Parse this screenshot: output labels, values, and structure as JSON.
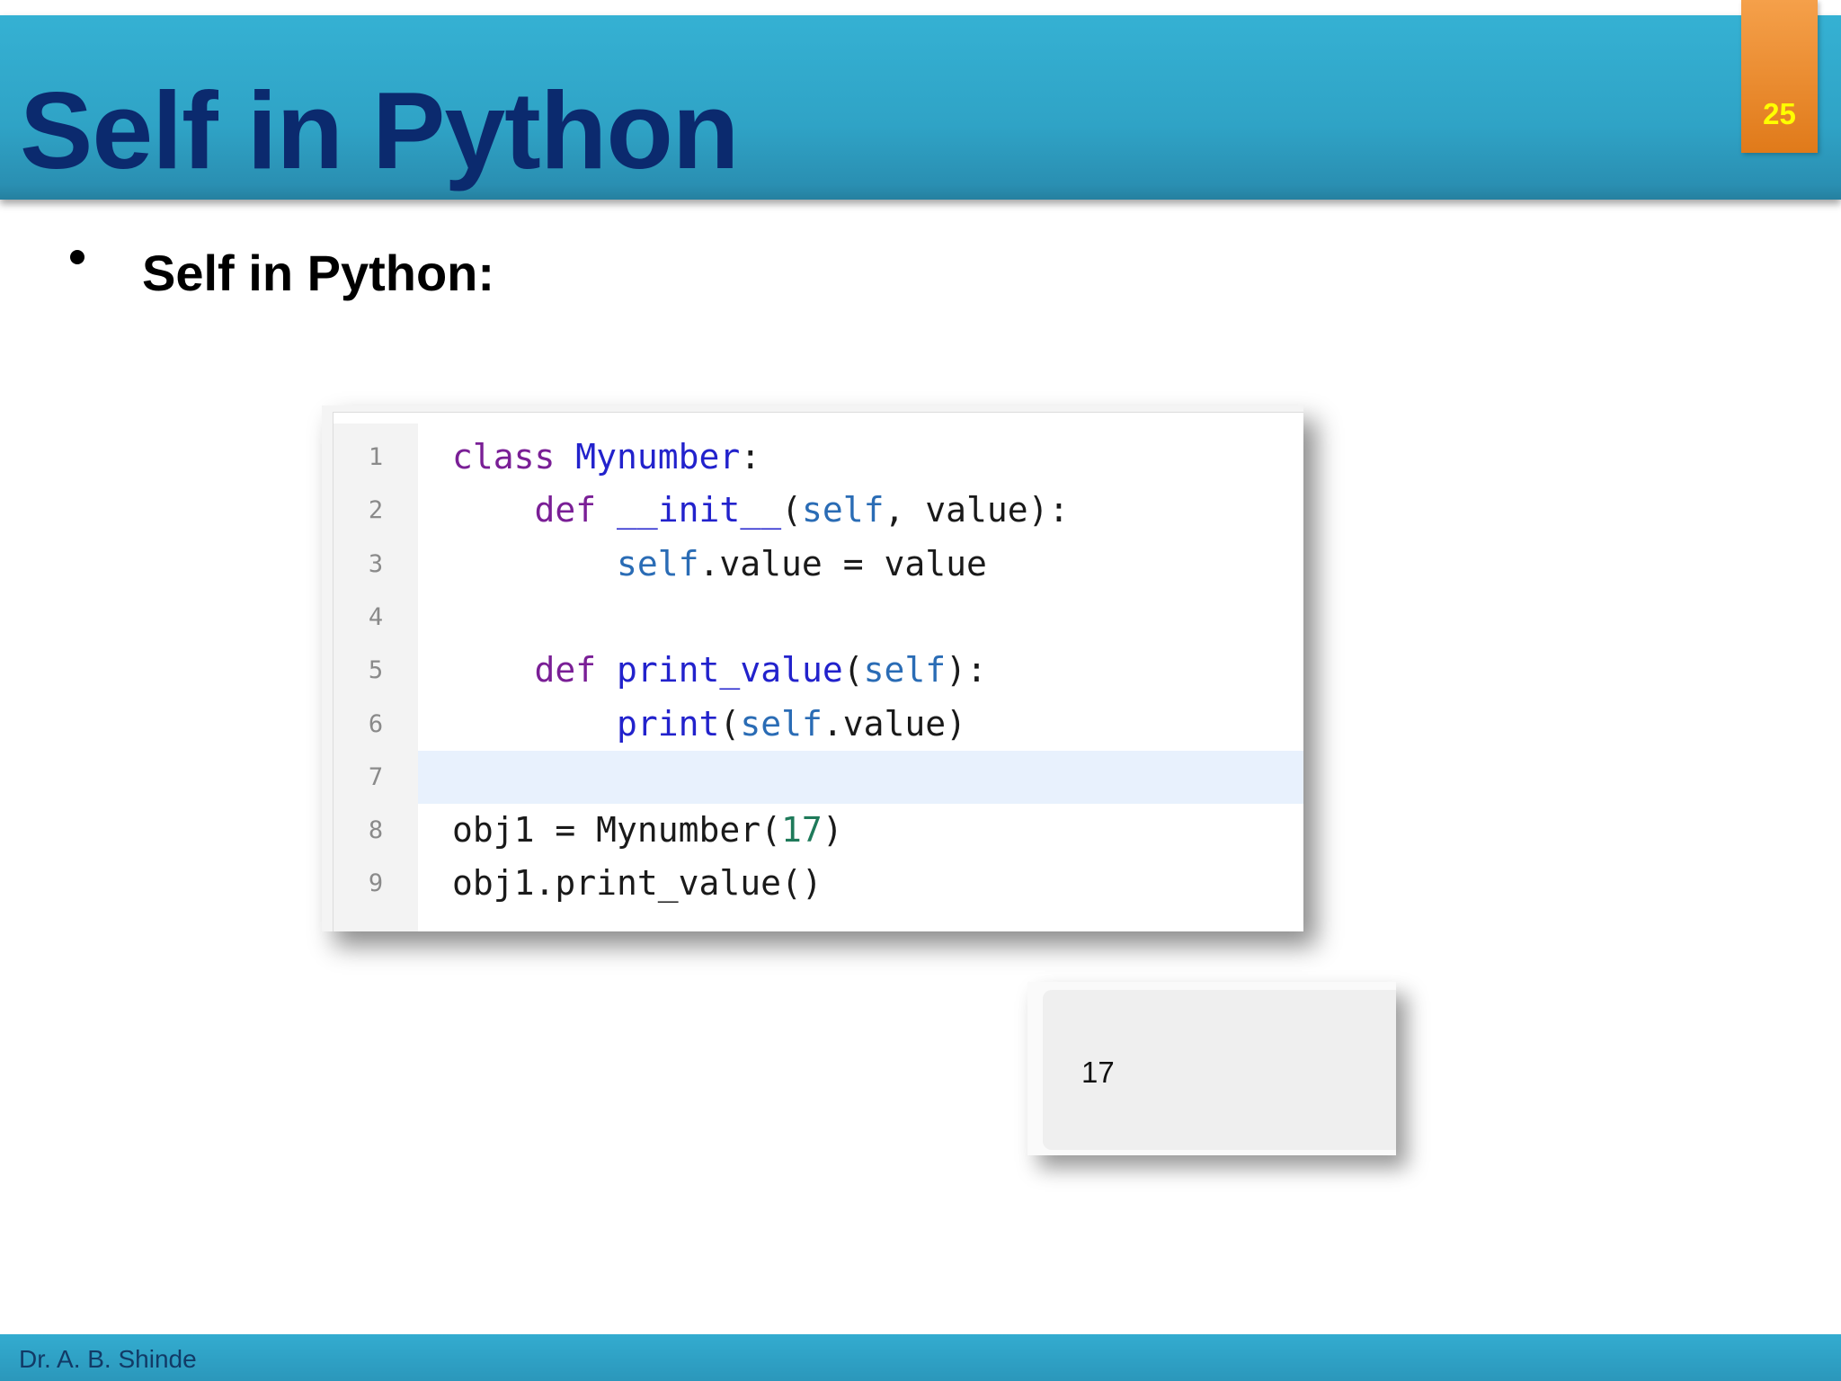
{
  "slide": {
    "title": "Self in Python",
    "page_number": "25",
    "bullet": "Self in Python:"
  },
  "code": {
    "line_numbers": [
      "1",
      "2",
      "3",
      "4",
      "5",
      "6",
      "7",
      "8",
      "9"
    ],
    "lines": [
      [
        [
          "kw",
          "class"
        ],
        [
          "",
          " "
        ],
        [
          "nm",
          "Mynumber"
        ],
        [
          "",
          ":"
        ]
      ],
      [
        [
          "",
          "    "
        ],
        [
          "kw",
          "def"
        ],
        [
          "",
          " "
        ],
        [
          "nm",
          "__init__"
        ],
        [
          "",
          "("
        ],
        [
          "bi",
          "self"
        ],
        [
          "",
          ", value):"
        ]
      ],
      [
        [
          "",
          "        "
        ],
        [
          "bi",
          "self"
        ],
        [
          "",
          ".value = value"
        ]
      ],
      [],
      [
        [
          "",
          "    "
        ],
        [
          "kw",
          "def"
        ],
        [
          "",
          " "
        ],
        [
          "nm",
          "print_value"
        ],
        [
          "",
          "("
        ],
        [
          "bi",
          "self"
        ],
        [
          "",
          "):"
        ]
      ],
      [
        [
          "",
          "        "
        ],
        [
          "nm",
          "print"
        ],
        [
          "",
          "("
        ],
        [
          "bi",
          "self"
        ],
        [
          "",
          ".value)"
        ]
      ],
      [],
      [
        [
          "",
          "obj1 = Mynumber("
        ],
        [
          "num",
          "17"
        ],
        [
          "",
          ")"
        ]
      ],
      [
        [
          "",
          "obj1.print_value()"
        ]
      ]
    ],
    "highlighted_line": "7"
  },
  "output": {
    "text": "17"
  },
  "footer": {
    "author": "Dr. A. B. Shinde"
  },
  "colors": {
    "header_band": "#2fa3c6",
    "title": "#0b2a6e",
    "page_tab": "#e88a2a",
    "page_number": "#ffff00",
    "keyword": "#7a1f96",
    "name": "#2222cc",
    "builtin_self": "#2a6cb5",
    "number": "#1f7a5a",
    "highlight_line": "#e8f1fd"
  }
}
